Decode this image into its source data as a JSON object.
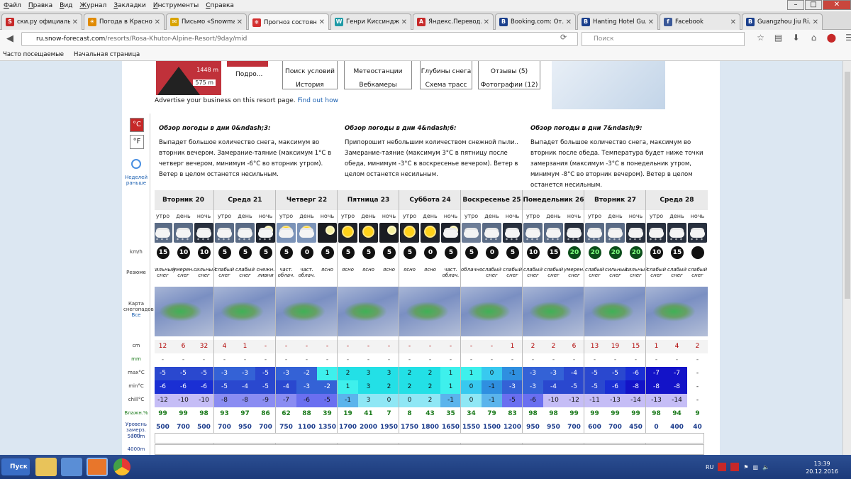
{
  "menu": [
    {
      "label": "Файл",
      "key": "Ф"
    },
    {
      "label": "Правка",
      "key": "П"
    },
    {
      "label": "Вид",
      "key": "В"
    },
    {
      "label": "Журнал",
      "key": "Ж"
    },
    {
      "label": "Закладки",
      "key": "З"
    },
    {
      "label": "Инструменты",
      "key": "И"
    },
    {
      "label": "Справка",
      "key": "С"
    }
  ],
  "tabs": [
    {
      "label": "ски.ру официаль...",
      "icon_color": "#c62828",
      "icon": "S"
    },
    {
      "label": "Погода в Красно...",
      "icon_color": "#e08a00",
      "icon": "☀"
    },
    {
      "label": "Письмо «Snowma...",
      "icon_color": "#d9a300",
      "icon": "✉"
    },
    {
      "label": "Прогноз состоян...",
      "icon_color": "#d32f2f",
      "icon": "❄",
      "active": true
    },
    {
      "label": "Генри Киссиндж...",
      "icon_color": "#1e9aa6",
      "icon": "W"
    },
    {
      "label": "Яндекс.Перевод...",
      "icon_color": "#c62828",
      "icon": "A"
    },
    {
      "label": "Booking.com: От...",
      "icon_color": "#1a3f8c",
      "icon": "B"
    },
    {
      "label": "Hanting Hotel Gu...",
      "icon_color": "#1a3f8c",
      "icon": "B"
    },
    {
      "label": "Facebook",
      "icon_color": "#3b5998",
      "icon": "f"
    },
    {
      "label": "Guangzhou Jiu Ri...",
      "icon_color": "#1a3f8c",
      "icon": "B"
    }
  ],
  "url": {
    "host": "ru.snow-forecast.com",
    "path": "/resorts/Rosa-Khutor-Alpine-Resort/9day/mid"
  },
  "search_placeholder": "Поиск",
  "bookmarks": [
    "Часто посещаемые",
    "Начальная страница"
  ],
  "header": {
    "top_elev": "1448 m",
    "bottom_elev": "575 m",
    "podro": "Подро...",
    "nav": [
      {
        "l1": "Поиск условий",
        "l2": "История"
      },
      {
        "l1": "Метеостанции",
        "l2": "Вебкамеры"
      },
      {
        "l1": "Глубины снега",
        "l2": "Схема трасс"
      },
      {
        "l1": "Отзывы (5)",
        "l2": "Фотографии (12)"
      }
    ]
  },
  "advert": {
    "text": "Advertise your business on this resort page.",
    "link": "Find out how"
  },
  "units": {
    "c": "°C",
    "f": "°F"
  },
  "earlier": "Неделей раньше",
  "row_labels": {
    "wind": "km/h",
    "summary": "Резюме",
    "map": "Карта снегопадов",
    "map_link": "Все",
    "snow": "cm",
    "rain": "mm",
    "max": "max°C",
    "min": "min°C",
    "chill": "chill°C",
    "hum": "Влажн.%",
    "frz": "Уровень замерз. (m)",
    "alt1": "5000m",
    "alt2": "4000m"
  },
  "summaries": [
    {
      "title": "Обзор погоды в дни 0&ndash;3:",
      "text": "Выпадет большое количество снега, максимум во вторник вечером. Замерание-таяние (максимум 1°C в четверг вечером, минимум -6°C во вторник утром). Ветер в целом останется несильным."
    },
    {
      "title": "Обзор погоды в дни 4&ndash;6:",
      "text": "Припорошит небольшим количеством снежной пыли.. Замерание-таяние (максимум 3°C в пятницу после обеда, минимум -3°C в воскресенье вечером). Ветер в целом останется несильным."
    },
    {
      "title": "Обзор погоды в дни 7&ndash;9:",
      "text": "Выпадет большое количество снега, максимум во вторник после обеда. Температура будет ниже точки замерзания (максимум -3°C в понедельник утром, минимум -8°C во вторник вечером). Ветер в целом останется несильным."
    }
  ],
  "slot_names": [
    "утро",
    "день",
    "ночь"
  ],
  "days": [
    {
      "name": "Вторник 20",
      "slots": [
        {
          "icon": "snow",
          "wind": "15",
          "wind_color": "w",
          "summary": "сильный снег",
          "snow": "12",
          "rain": "-",
          "max": "-5",
          "min": "-6",
          "chill": "-12",
          "hum": "99",
          "frz": "500"
        },
        {
          "icon": "snow",
          "wind": "10",
          "wind_color": "w",
          "summary": "умерен. снег",
          "snow": "6",
          "rain": "-",
          "max": "-5",
          "min": "-6",
          "chill": "-10",
          "hum": "99",
          "frz": "700"
        },
        {
          "icon": "snownight",
          "wind": "10",
          "wind_color": "w",
          "summary": "сильный снег",
          "snow": "32",
          "rain": "-",
          "max": "-5",
          "min": "-6",
          "chill": "-10",
          "hum": "98",
          "frz": "500"
        }
      ]
    },
    {
      "name": "Среда 21",
      "slots": [
        {
          "icon": "snow",
          "wind": "5",
          "wind_color": "w",
          "summary": "слабый снег",
          "snow": "4",
          "rain": "-",
          "max": "-3",
          "min": "-5",
          "chill": "-8",
          "hum": "93",
          "frz": "700"
        },
        {
          "icon": "snow",
          "wind": "5",
          "wind_color": "w",
          "summary": "слабый снег",
          "snow": "1",
          "rain": "-",
          "max": "-3",
          "min": "-4",
          "chill": "-8",
          "hum": "97",
          "frz": "950"
        },
        {
          "icon": "moon",
          "wind": "5",
          "wind_color": "w",
          "summary": "снежн. ливни",
          "snow": "-",
          "rain": "-",
          "max": "-5",
          "min": "-5",
          "chill": "-9",
          "hum": "86",
          "frz": "700"
        }
      ]
    },
    {
      "name": "Четверг 22",
      "slots": [
        {
          "icon": "suncloud",
          "wind": "5",
          "wind_color": "w",
          "summary": "част. облач.",
          "snow": "-",
          "rain": "-",
          "max": "-3",
          "min": "-4",
          "chill": "-7",
          "hum": "62",
          "frz": "750"
        },
        {
          "icon": "suncloud",
          "wind": "0",
          "wind_color": "w",
          "summary": "част. облач.",
          "snow": "-",
          "rain": "-",
          "max": "-2",
          "min": "-3",
          "chill": "-6",
          "hum": "88",
          "frz": "1100"
        },
        {
          "icon": "moonclear",
          "wind": "5",
          "wind_color": "w",
          "summary": "ясно",
          "snow": "-",
          "rain": "-",
          "max": "1",
          "min": "-2",
          "chill": "-5",
          "hum": "39",
          "frz": "1350"
        }
      ]
    },
    {
      "name": "Пятница 23",
      "slots": [
        {
          "icon": "sun",
          "wind": "5",
          "wind_color": "w",
          "summary": "ясно",
          "snow": "-",
          "rain": "-",
          "max": "2",
          "min": "1",
          "chill": "-1",
          "hum": "19",
          "frz": "1700"
        },
        {
          "icon": "sun",
          "wind": "5",
          "wind_color": "w",
          "summary": "ясно",
          "snow": "-",
          "rain": "-",
          "max": "3",
          "min": "3",
          "chill": "3",
          "hum": "41",
          "frz": "2000"
        },
        {
          "icon": "moonclear",
          "wind": "5",
          "wind_color": "w",
          "summary": "ясно",
          "snow": "-",
          "rain": "-",
          "max": "3",
          "min": "2",
          "chill": "0",
          "hum": "7",
          "frz": "1950"
        }
      ]
    },
    {
      "name": "Суббота 24",
      "slots": [
        {
          "icon": "sun",
          "wind": "5",
          "wind_color": "w",
          "summary": "ясно",
          "snow": "-",
          "rain": "-",
          "max": "2",
          "min": "2",
          "chill": "0",
          "hum": "8",
          "frz": "1750"
        },
        {
          "icon": "sun",
          "wind": "0",
          "wind_color": "w",
          "summary": "ясно",
          "snow": "-",
          "rain": "-",
          "max": "2",
          "min": "2",
          "chill": "2",
          "hum": "43",
          "frz": "1800"
        },
        {
          "icon": "moon",
          "wind": "5",
          "wind_color": "w",
          "summary": "част. облач.",
          "snow": "-",
          "rain": "-",
          "max": "1",
          "min": "1",
          "chill": "-1",
          "hum": "35",
          "frz": "1650"
        }
      ]
    },
    {
      "name": "Воскресенье 25",
      "slots": [
        {
          "icon": "cloud",
          "wind": "5",
          "wind_color": "w",
          "summary": "облачно",
          "snow": "-",
          "rain": "-",
          "max": "1",
          "min": "0",
          "chill": "0",
          "hum": "34",
          "frz": "1550"
        },
        {
          "icon": "snow",
          "wind": "0",
          "wind_color": "w",
          "summary": "слабый снег",
          "snow": "-",
          "rain": "-",
          "max": "0",
          "min": "-1",
          "chill": "-1",
          "hum": "79",
          "frz": "1500"
        },
        {
          "icon": "snownight",
          "wind": "5",
          "wind_color": "w",
          "summary": "слабый снег",
          "snow": "1",
          "rain": "-",
          "max": "-1",
          "min": "-3",
          "chill": "-5",
          "hum": "83",
          "frz": "1200"
        }
      ]
    },
    {
      "name": "Понедельник 26",
      "slots": [
        {
          "icon": "snow",
          "wind": "10",
          "wind_color": "w",
          "summary": "слабый снег",
          "snow": "2",
          "rain": "-",
          "max": "-3",
          "min": "-3",
          "chill": "-6",
          "hum": "98",
          "frz": "950"
        },
        {
          "icon": "snow",
          "wind": "15",
          "wind_color": "w",
          "summary": "слабый снег",
          "snow": "2",
          "rain": "-",
          "max": "-3",
          "min": "-4",
          "chill": "-10",
          "hum": "98",
          "frz": "950"
        },
        {
          "icon": "snownight",
          "wind": "20",
          "wind_color": "g",
          "summary": "умерен. снег",
          "snow": "6",
          "rain": "-",
          "max": "-4",
          "min": "-5",
          "chill": "-12",
          "hum": "99",
          "frz": "700"
        }
      ]
    },
    {
      "name": "Вторник 27",
      "slots": [
        {
          "icon": "snow",
          "wind": "20",
          "wind_color": "g",
          "summary": "слабый снег",
          "snow": "13",
          "rain": "-",
          "max": "-5",
          "min": "-5",
          "chill": "-11",
          "hum": "99",
          "frz": "600"
        },
        {
          "icon": "snow",
          "wind": "20",
          "wind_color": "g",
          "summary": "сильный снег",
          "snow": "19",
          "rain": "-",
          "max": "-5",
          "min": "-6",
          "chill": "-13",
          "hum": "99",
          "frz": "700"
        },
        {
          "icon": "snownight",
          "wind": "20",
          "wind_color": "g",
          "summary": "сильный снег",
          "snow": "15",
          "rain": "-",
          "max": "-6",
          "min": "-8",
          "chill": "-14",
          "hum": "99",
          "frz": "450"
        }
      ]
    },
    {
      "name": "Среда 28",
      "slots": [
        {
          "icon": "snownight",
          "wind": "10",
          "wind_color": "w",
          "summary": "слабый снег",
          "snow": "1",
          "rain": "-",
          "max": "-7",
          "min": "-8",
          "chill": "-13",
          "hum": "98",
          "frz": "0"
        },
        {
          "icon": "snownight",
          "wind": "15",
          "wind_color": "w",
          "summary": "слабый снег",
          "snow": "4",
          "rain": "-",
          "max": "-7",
          "min": "-8",
          "chill": "-14",
          "hum": "94",
          "frz": "400"
        },
        {
          "icon": "snownight",
          "wind": "",
          "wind_color": "w",
          "summary": "слабый снег",
          "snow": "2",
          "rain": "-",
          "max": "-",
          "min": "-",
          "chill": "-",
          "hum": "9",
          "frz": "40"
        }
      ]
    }
  ],
  "taskbar": {
    "start": "Пуск",
    "lang": "RU",
    "time": "13:39",
    "date": "20.12.2016"
  }
}
